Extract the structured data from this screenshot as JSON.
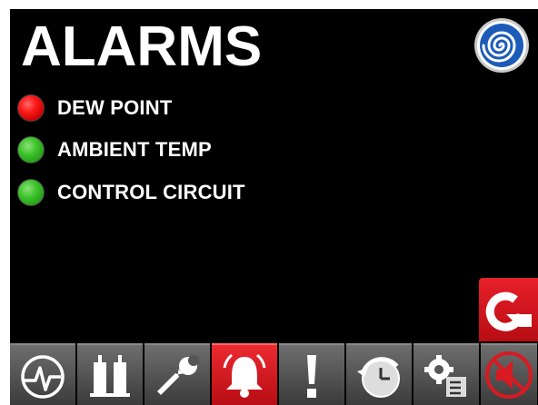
{
  "screen": {
    "title": "ALARMS",
    "logo_icon": "spiral-logo-icon"
  },
  "alarms": [
    {
      "label": "DEW POINT",
      "status": "red",
      "color": "#e81c1c"
    },
    {
      "label": "AMBIENT TEMP",
      "status": "green",
      "color": "#3cc22a"
    },
    {
      "label": "CONTROL CIRCUIT",
      "status": "green",
      "color": "#3cc22a"
    }
  ],
  "reset_button": {
    "icon": "reset-arrow-icon",
    "color": "#d81a22"
  },
  "toolbar": {
    "buttons": [
      {
        "icon": "waveform-icon",
        "active": false
      },
      {
        "icon": "dryer-towers-icon",
        "active": false
      },
      {
        "icon": "wrench-icon",
        "active": false
      },
      {
        "icon": "alarm-bell-icon",
        "active": true
      },
      {
        "icon": "exclamation-icon",
        "active": false
      },
      {
        "icon": "clock-history-icon",
        "active": false
      },
      {
        "icon": "settings-checklist-icon",
        "active": false
      },
      {
        "icon": "speaker-muted-icon",
        "active": false
      }
    ],
    "accent_color": "#d81a22",
    "button_color": "#5a5a5a"
  }
}
